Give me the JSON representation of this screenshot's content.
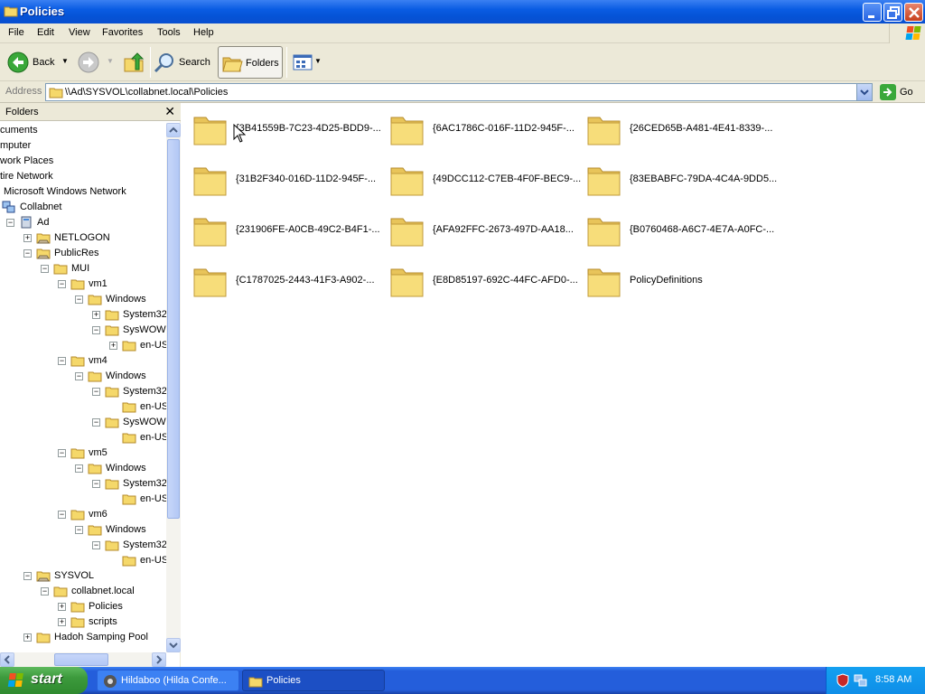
{
  "window": {
    "title": "Policies"
  },
  "menu": [
    "File",
    "Edit",
    "View",
    "Favorites",
    "Tools",
    "Help"
  ],
  "toolbar": {
    "back": "Back",
    "search": "Search",
    "folders": "Folders"
  },
  "address": {
    "label": "Address",
    "value": "\\\\Ad\\SYSVOL\\collabnet.local\\Policies",
    "go": "Go"
  },
  "folders_pane": {
    "title": "Folders"
  },
  "tree": [
    {
      "label": "cuments",
      "expander": ""
    },
    {
      "label": "mputer",
      "expander": ""
    },
    {
      "label": "work Places",
      "expander": ""
    },
    {
      "label": "tire Network",
      "expander": ""
    },
    {
      "label": "Microsoft Windows Network",
      "expander": ""
    },
    {
      "label": "Collabnet",
      "expander": ""
    },
    {
      "label": "Ad",
      "expander": "−"
    },
    {
      "label": "NETLOGON",
      "expander": "+"
    },
    {
      "label": "PublicRes",
      "expander": "−"
    },
    {
      "label": "MUI",
      "expander": "−"
    },
    {
      "label": "vm1",
      "expander": "−"
    },
    {
      "label": "Windows",
      "expander": "−"
    },
    {
      "label": "System32",
      "expander": "+"
    },
    {
      "label": "SysWOW",
      "expander": "−"
    },
    {
      "label": "en-US",
      "expander": "+"
    },
    {
      "label": "vm4",
      "expander": "−"
    },
    {
      "label": "Windows",
      "expander": "−"
    },
    {
      "label": "System32",
      "expander": "−"
    },
    {
      "label": "en-US",
      "expander": ""
    },
    {
      "label": "SysWOW",
      "expander": "−"
    },
    {
      "label": "en-US",
      "expander": ""
    },
    {
      "label": "vm5",
      "expander": "−"
    },
    {
      "label": "Windows",
      "expander": "−"
    },
    {
      "label": "System32",
      "expander": "−"
    },
    {
      "label": "en-US",
      "expander": ""
    },
    {
      "label": "vm6",
      "expander": "−"
    },
    {
      "label": "Windows",
      "expander": "−"
    },
    {
      "label": "System32",
      "expander": "−"
    },
    {
      "label": "en-US",
      "expander": ""
    },
    {
      "label": "SYSVOL",
      "expander": "−"
    },
    {
      "label": "collabnet.local",
      "expander": "−"
    },
    {
      "label": "Policies",
      "expander": "+"
    },
    {
      "label": "scripts",
      "expander": "+"
    },
    {
      "label": "Hadoh Samping Pool",
      "expander": "+"
    }
  ],
  "content_items": [
    "{3B41559B-7C23-4D25-BDD9-...",
    "{6AC1786C-016F-11D2-945F-...",
    "{26CED65B-A481-4E41-8339-...",
    "{31B2F340-016D-11D2-945F-...",
    "{49DCC112-C7EB-4F0F-BEC9-...",
    "{83EBABFC-79DA-4C4A-9DD5...",
    "{231906FE-A0CB-49C2-B4F1-...",
    "{AFA92FFC-2673-497D-AA18...",
    "{B0760468-A6C7-4E7A-A0FC-...",
    "{C1787025-2443-41F3-A902-...",
    "{E8D85197-692C-44FC-AFD0-...",
    "PolicyDefinitions"
  ],
  "taskbar": {
    "start": "start",
    "tasks": [
      "Hildaboo (Hilda Confe...",
      "Policies"
    ],
    "clock": "8:58 AM"
  },
  "colors": {
    "titlebar": "#0a5ce3",
    "chrome": "#ece9d8",
    "taskbar": "#245edb",
    "start": "#3c9a3c",
    "folder": "#f5d86a"
  },
  "icons": [
    "folder-icon",
    "back-arrow-icon",
    "forward-arrow-icon",
    "up-folder-icon",
    "search-icon",
    "folders-icon",
    "views-icon",
    "go-arrow-icon",
    "windows-flag-icon",
    "network-icon",
    "computer-icon",
    "share-icon",
    "mouse-cursor-icon",
    "shield-icon",
    "network-tray-icon"
  ]
}
